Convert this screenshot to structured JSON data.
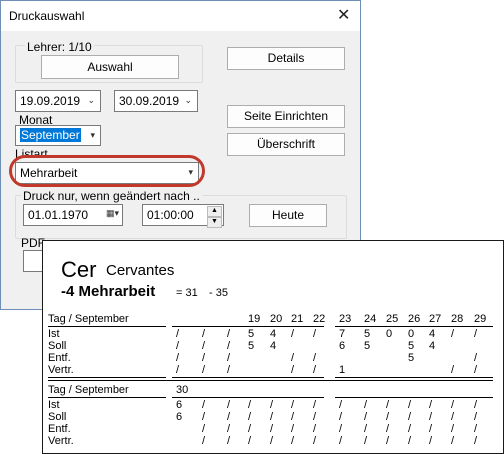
{
  "dialog": {
    "title": "Druckauswahl",
    "close_glyph": "✕",
    "teacher_label": "Lehrer: 1/10",
    "select_button": "Auswahl",
    "details_button": "Details",
    "date_from": "19.09.2019",
    "date_to": "30.09.2019",
    "month_label": "Monat",
    "month_value": "September",
    "page_setup_button": "Seite Einrichten",
    "heading_button": "Überschrift",
    "list_type_label": "Listart",
    "list_type_value": "Mehrarbeit",
    "print_changed_label": "Druck nur, wenn geändert nach ..",
    "changed_date": "01.01.1970",
    "changed_time": "01:00:00",
    "today_button": "Heute",
    "pdf_label": "PDF"
  },
  "report": {
    "teacher_short": "Cer",
    "teacher_name": "Cervantes",
    "list_title": "-4 Mehrarbeit",
    "sum1": "= 31",
    "sum2": "- 35",
    "block1": {
      "header": "Tag / September",
      "days": [
        "",
        "",
        "",
        "19",
        "20",
        "21",
        "22",
        "23",
        "24",
        "25",
        "26",
        "27",
        "28",
        "29"
      ],
      "rows": [
        {
          "label": "Ist",
          "cells": [
            "/",
            "/",
            "/",
            "5",
            "4",
            "/",
            "/",
            "7",
            "5",
            "0",
            "0",
            "4",
            "/",
            "/"
          ]
        },
        {
          "label": "Soll",
          "cells": [
            "/",
            "/",
            "/",
            "5",
            "4",
            "",
            "",
            "6",
            "5",
            "",
            "5",
            "4",
            "",
            ""
          ]
        },
        {
          "label": "Entf.",
          "cells": [
            "/",
            "/",
            "/",
            "",
            "",
            "/",
            "/",
            "",
            "",
            "",
            "5",
            "",
            "",
            "/"
          ]
        },
        {
          "label": "Vertr.",
          "cells": [
            "/",
            "/",
            "/",
            "",
            "",
            "/",
            "/",
            "1",
            "",
            "",
            "",
            "",
            "/",
            "/"
          ]
        }
      ]
    },
    "block2": {
      "header": "Tag / September",
      "days": [
        "30",
        "",
        "",
        "",
        "",
        "",
        "",
        "",
        "",
        "",
        "",
        "",
        "",
        ""
      ],
      "rows": [
        {
          "label": "Ist",
          "cells": [
            "6",
            "/",
            "/",
            "/",
            "/",
            "/",
            "/",
            "/",
            "/",
            "/",
            "/",
            "/",
            "/",
            "/"
          ]
        },
        {
          "label": "Soll",
          "cells": [
            "6",
            "/",
            "/",
            "/",
            "/",
            "/",
            "/",
            "/",
            "/",
            "/",
            "/",
            "/",
            "/",
            "/"
          ]
        },
        {
          "label": "Entf.",
          "cells": [
            "",
            "/",
            "/",
            "/",
            "/",
            "/",
            "/",
            "/",
            "/",
            "/",
            "/",
            "/",
            "/",
            "/"
          ]
        },
        {
          "label": "Vertr.",
          "cells": [
            "",
            "/",
            "/",
            "/",
            "/",
            "/",
            "/",
            "/",
            "/",
            "/",
            "/",
            "/",
            "/",
            "/"
          ]
        }
      ]
    }
  }
}
